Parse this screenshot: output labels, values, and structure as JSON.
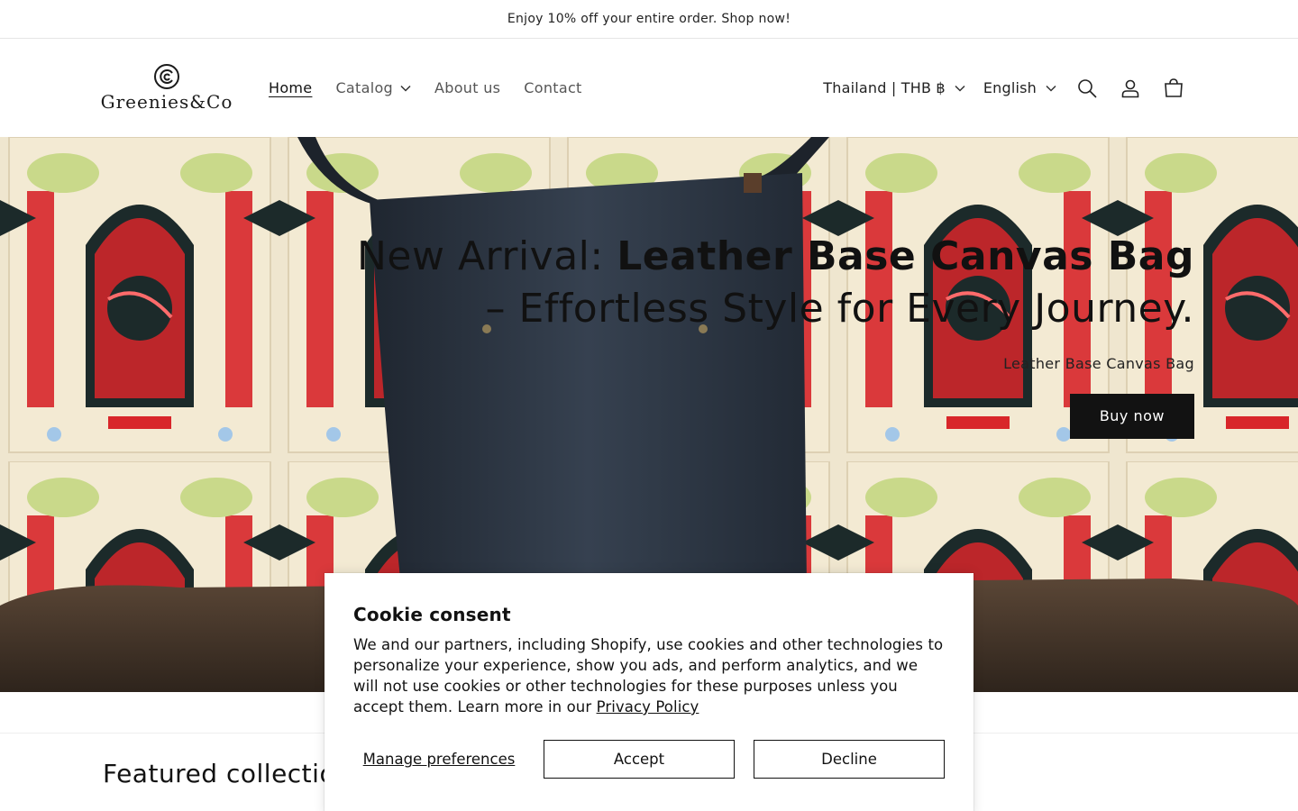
{
  "announcement": {
    "text": "Enjoy 10% off your entire order. Shop now!"
  },
  "header": {
    "logo_text": "Greenies&Co",
    "nav": [
      {
        "label": "Home",
        "active": true
      },
      {
        "label": "Catalog",
        "has_dropdown": true
      },
      {
        "label": "About us"
      },
      {
        "label": "Contact"
      }
    ],
    "country_selector": "Thailand | THB ฿",
    "language_selector": "English",
    "icons": [
      "search-icon",
      "account-icon",
      "cart-icon"
    ]
  },
  "hero": {
    "title_light": "New Arrival: ",
    "title_bold": "Leather Base Canvas Bag",
    "title_rest": " – Effortless Style for Every Journey.",
    "subtitle": "Leather Base Canvas Bag",
    "button": "Buy now"
  },
  "featured": {
    "title": "Featured collection"
  },
  "cookie": {
    "title": "Cookie consent",
    "body": "We and our partners, including Shopify, use cookies and other technologies to personalize your experience, show you ads, and perform analytics, and we will not use cookies or other technologies for these purposes unless you accept them. Learn more in our ",
    "link": "Privacy Policy",
    "manage": "Manage preferences",
    "accept": "Accept",
    "decline": "Decline"
  },
  "colors": {
    "text": "#121212",
    "button_bg": "#121212",
    "poster_red": "#d8262a",
    "poster_green": "#c9d98a",
    "bag": "#2b3340"
  }
}
